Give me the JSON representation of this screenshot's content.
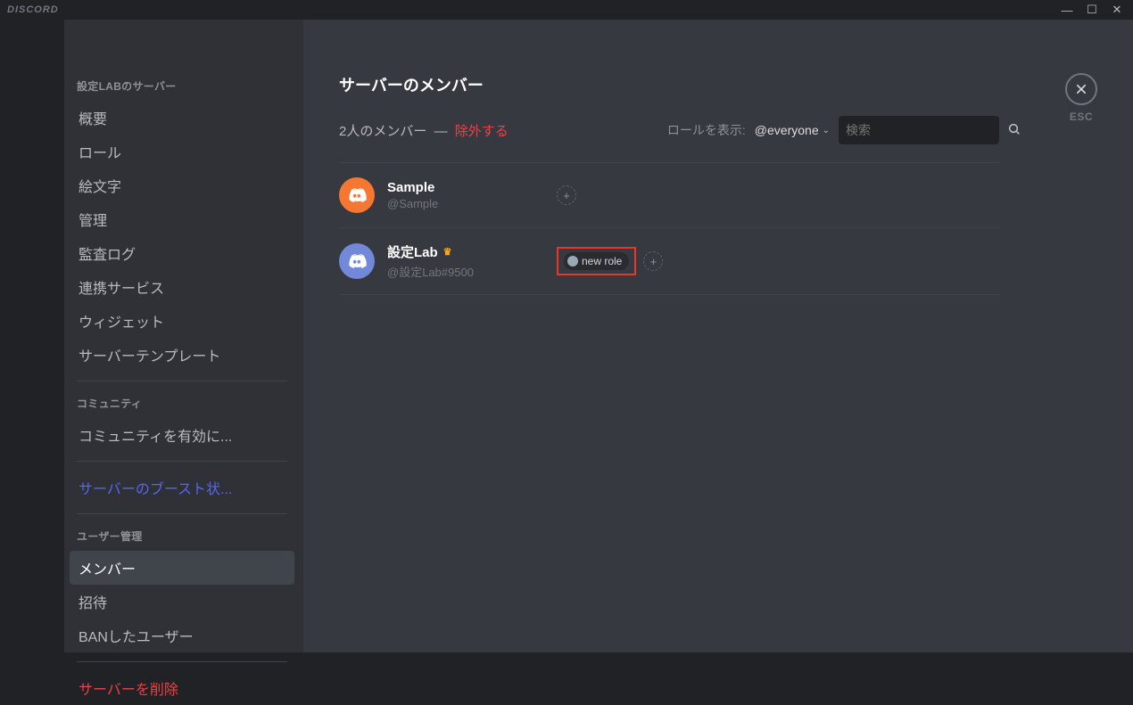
{
  "titlebar": {
    "brand": "DISCORD"
  },
  "sidebar": {
    "section_server": "設定LABのサーバー",
    "overview": "概要",
    "roles": "ロール",
    "emoji": "絵文字",
    "moderation": "管理",
    "audit": "監査ログ",
    "integrations": "連携サービス",
    "widget": "ウィジェット",
    "template": "サーバーテンプレート",
    "section_community": "コミュニティ",
    "enable_community": "コミュニティを有効に...",
    "boost": "サーバーのブースト状...",
    "section_user": "ユーザー管理",
    "members": "メンバー",
    "invites": "招待",
    "bans": "BANしたユーザー",
    "delete": "サーバーを削除"
  },
  "page": {
    "title": "サーバーのメンバー",
    "count": "2人のメンバー",
    "dash": "—",
    "prune": "除外する",
    "role_label": "ロールを表示:",
    "role_value": "@everyone",
    "search_placeholder": "検索"
  },
  "members": [
    {
      "name": "Sample",
      "tag": "@Sample",
      "avatarClass": "orange",
      "roles": [],
      "owner": false
    },
    {
      "name": "設定Lab",
      "tag": "@設定Lab#9500",
      "avatarClass": "blurple",
      "roles": [
        {
          "label": "new role",
          "highlight": true
        }
      ],
      "owner": true
    }
  ],
  "close": {
    "esc": "ESC"
  }
}
